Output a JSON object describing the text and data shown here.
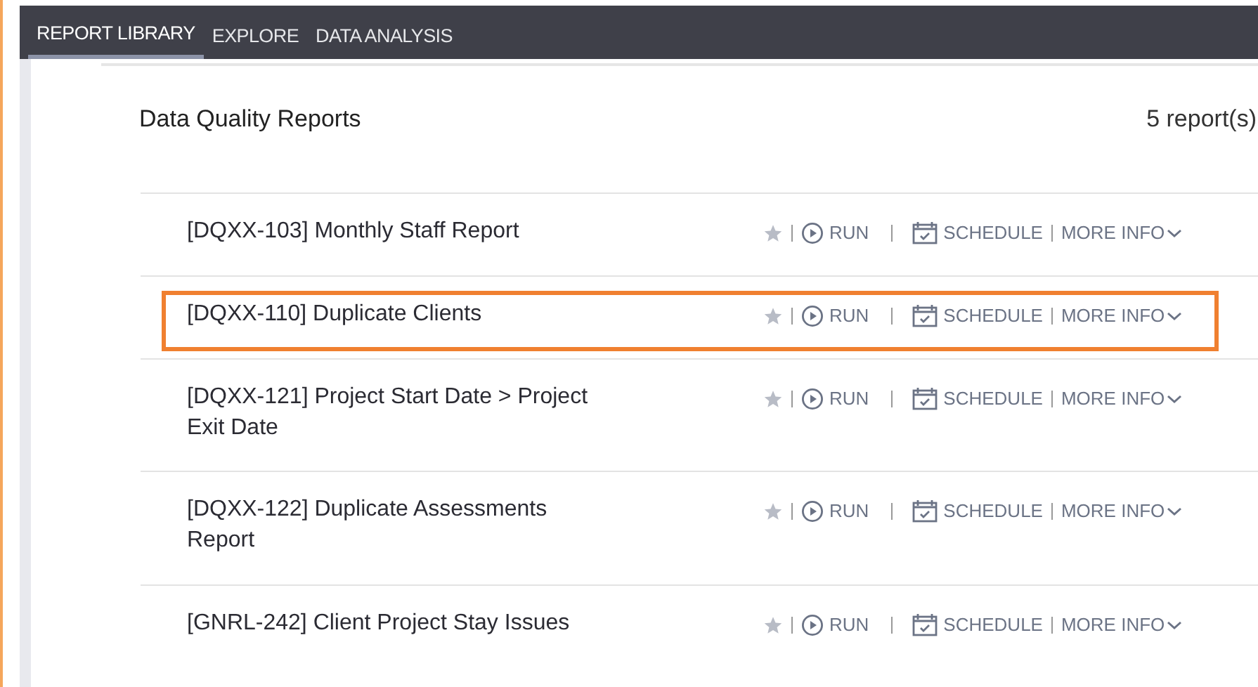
{
  "tabs": [
    {
      "label": "REPORT LIBRARY",
      "selected": true
    },
    {
      "label": "EXPLORE",
      "selected": false
    },
    {
      "label": "DATA ANALYSIS",
      "selected": false
    }
  ],
  "section": {
    "title": "Data Quality Reports",
    "count": "5 report(s)"
  },
  "reports": [
    {
      "title": "[DQXX-103] Monthly Staff Report",
      "highlighted": false,
      "actions": {
        "run": "RUN",
        "schedule": "SCHEDULE",
        "more": "MORE INFO"
      }
    },
    {
      "title": "[DQXX-110] Duplicate Clients",
      "highlighted": true,
      "actions": {
        "run": "RUN",
        "schedule": "SCHEDULE",
        "more": "MORE INFO"
      }
    },
    {
      "title": "[DQXX-121] Project Start Date > Project Exit Date",
      "highlighted": false,
      "actions": {
        "run": "RUN",
        "schedule": "SCHEDULE",
        "more": "MORE INFO"
      }
    },
    {
      "title": "[DQXX-122] Duplicate Assessments Report",
      "highlighted": false,
      "actions": {
        "run": "RUN",
        "schedule": "SCHEDULE",
        "more": "MORE INFO"
      }
    },
    {
      "title": "[GNRL-242] Client Project Stay Issues",
      "highlighted": false,
      "actions": {
        "run": "RUN",
        "schedule": "SCHEDULE",
        "more": "MORE INFO"
      }
    }
  ]
}
